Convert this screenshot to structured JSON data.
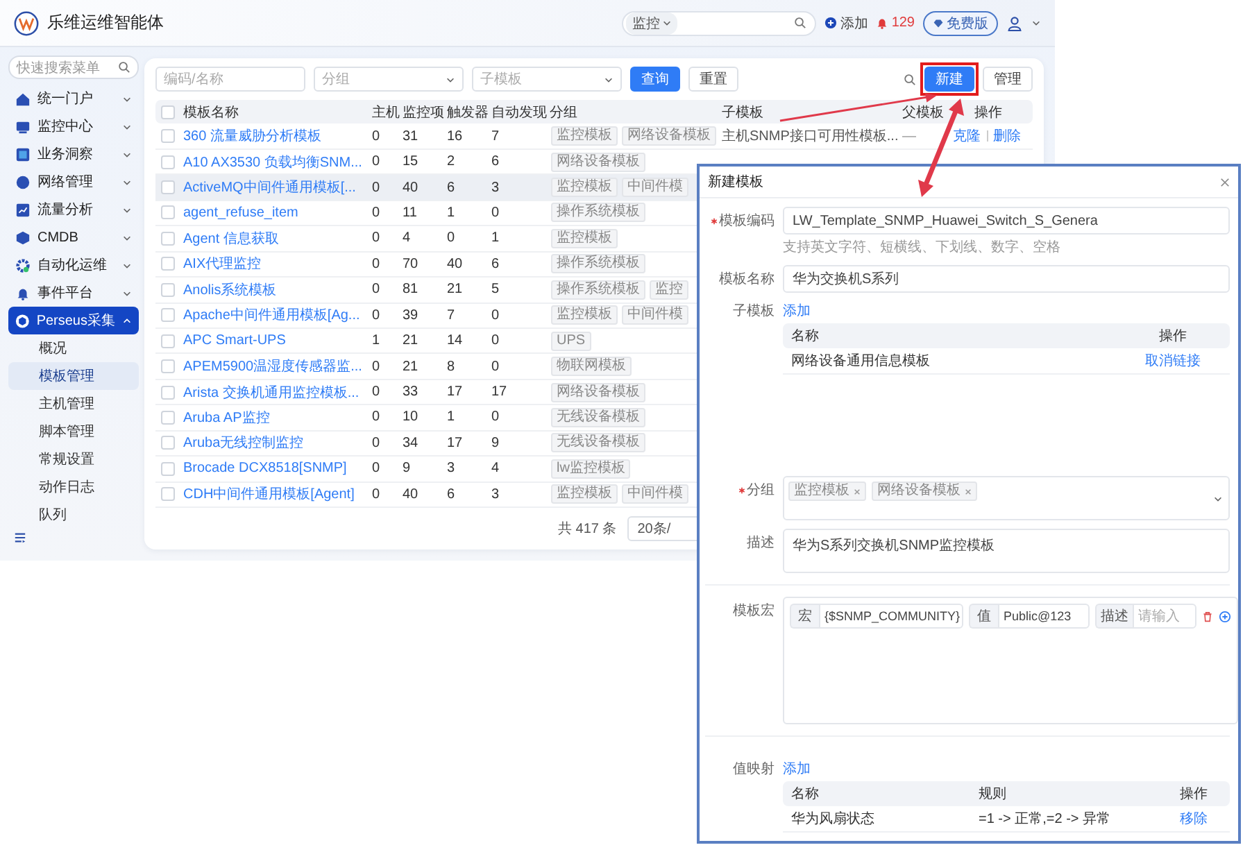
{
  "header": {
    "title": "乐维运维智能体",
    "search_scope": "监控",
    "add": "添加",
    "alert_count": "129",
    "plan": "免费版"
  },
  "sidebar": {
    "search_placeholder": "快速搜索菜单",
    "items": [
      {
        "label": "统一门户",
        "selected": false,
        "expanded": false
      },
      {
        "label": "监控中心",
        "selected": false,
        "expanded": false
      },
      {
        "label": "业务洞察",
        "selected": false,
        "expanded": false
      },
      {
        "label": "网络管理",
        "selected": false,
        "expanded": false
      },
      {
        "label": "流量分析",
        "selected": false,
        "expanded": false
      },
      {
        "label": "CMDB",
        "selected": false,
        "expanded": false
      },
      {
        "label": "自动化运维",
        "selected": false,
        "expanded": false
      },
      {
        "label": "事件平台",
        "selected": false,
        "expanded": false
      },
      {
        "label": "Perseus采集",
        "selected": true,
        "expanded": true,
        "children": [
          {
            "label": "概况",
            "selected": false
          },
          {
            "label": "模板管理",
            "selected": true
          },
          {
            "label": "主机管理",
            "selected": false
          },
          {
            "label": "脚本管理",
            "selected": false
          },
          {
            "label": "常规设置",
            "selected": false
          },
          {
            "label": "动作日志",
            "selected": false
          },
          {
            "label": "队列",
            "selected": false
          }
        ]
      }
    ]
  },
  "filters": {
    "code_placeholder": "编码/名称",
    "group_placeholder": "分组",
    "sub_placeholder": "子模板",
    "query": "查询",
    "reset": "重置",
    "create": "新建",
    "manage": "管理"
  },
  "table": {
    "select_all_checked": false,
    "columns": [
      "模板名称",
      "主机",
      "监控项",
      "触发器",
      "自动发现",
      "分组",
      "子模板",
      "父模板",
      "操作"
    ],
    "rows": [
      {
        "name": "360 流量威胁分析模板",
        "hosts": "0",
        "items": "31",
        "triggers": "16",
        "discovery": "7",
        "groups": [
          "监控模板",
          "网络设备模板"
        ],
        "sub_template": "主机SNMP接口可用性模板...",
        "parent_template": "—",
        "actions": [
          "克隆",
          "删除"
        ],
        "checked": false,
        "hovered": false
      },
      {
        "name": "A10 AX3530 负载均衡SNM...",
        "hosts": "0",
        "items": "15",
        "triggers": "2",
        "discovery": "6",
        "groups": [
          "网络设备模板"
        ],
        "checked": false,
        "hovered": false
      },
      {
        "name": "ActiveMQ中间件通用模板[...",
        "hosts": "0",
        "items": "40",
        "triggers": "6",
        "discovery": "3",
        "groups": [
          "监控模板",
          "中间件模"
        ],
        "checked": false,
        "hovered": true
      },
      {
        "name": "agent_refuse_item",
        "hosts": "0",
        "items": "11",
        "triggers": "1",
        "discovery": "0",
        "groups": [
          "操作系统模板"
        ],
        "checked": false,
        "hovered": false
      },
      {
        "name": "Agent 信息获取",
        "hosts": "0",
        "items": "4",
        "triggers": "0",
        "discovery": "1",
        "groups": [
          "监控模板"
        ],
        "checked": false,
        "hovered": false
      },
      {
        "name": "AIX代理监控",
        "hosts": "0",
        "items": "70",
        "triggers": "40",
        "discovery": "6",
        "groups": [
          "操作系统模板"
        ],
        "checked": false,
        "hovered": false
      },
      {
        "name": "Anolis系统模板",
        "hosts": "0",
        "items": "81",
        "triggers": "21",
        "discovery": "5",
        "groups": [
          "操作系统模板",
          "监控"
        ],
        "checked": false,
        "hovered": false
      },
      {
        "name": "Apache中间件通用模板[Ag...",
        "hosts": "0",
        "items": "39",
        "triggers": "7",
        "discovery": "0",
        "groups": [
          "监控模板",
          "中间件模"
        ],
        "checked": false,
        "hovered": false
      },
      {
        "name": "APC Smart-UPS",
        "hosts": "1",
        "items": "21",
        "triggers": "14",
        "discovery": "0",
        "groups": [
          "UPS"
        ],
        "checked": false,
        "hovered": false
      },
      {
        "name": "APEM5900温湿度传感器监...",
        "hosts": "0",
        "items": "21",
        "triggers": "8",
        "discovery": "0",
        "groups": [
          "物联网模板"
        ],
        "checked": false,
        "hovered": false
      },
      {
        "name": "Arista 交换机通用监控模板...",
        "hosts": "0",
        "items": "33",
        "triggers": "17",
        "discovery": "17",
        "groups": [
          "网络设备模板"
        ],
        "checked": false,
        "hovered": false
      },
      {
        "name": "Aruba AP监控",
        "hosts": "0",
        "items": "10",
        "triggers": "1",
        "discovery": "0",
        "groups": [
          "无线设备模板"
        ],
        "checked": false,
        "hovered": false
      },
      {
        "name": "Aruba无线控制监控",
        "hosts": "0",
        "items": "34",
        "triggers": "17",
        "discovery": "9",
        "groups": [
          "无线设备模板"
        ],
        "checked": false,
        "hovered": false
      },
      {
        "name": "Brocade DCX8518[SNMP]",
        "hosts": "0",
        "items": "9",
        "triggers": "3",
        "discovery": "4",
        "groups": [
          "lw监控模板"
        ],
        "checked": false,
        "hovered": false
      },
      {
        "name": "CDH中间件通用模板[Agent]",
        "hosts": "0",
        "items": "40",
        "triggers": "6",
        "discovery": "3",
        "groups": [
          "监控模板",
          "中间件模"
        ],
        "checked": false,
        "hovered": false
      }
    ]
  },
  "pagination": {
    "total": "共 417 条",
    "page_size": "20条/"
  },
  "dialog": {
    "title": "新建模板",
    "code": {
      "label": "模板编码",
      "required": true,
      "value": "LW_Template_SNMP_Huawei_Switch_S_Genera",
      "hint": "支持英文字符、短横线、下划线、数字、空格"
    },
    "name": {
      "label": "模板名称",
      "required": false,
      "value": "华为交换机S系列"
    },
    "sub_templates": {
      "label": "子模板",
      "add": "添加",
      "columns": [
        "名称",
        "操作"
      ],
      "rows": [
        {
          "name": "网络设备通用信息模板",
          "action": "取消链接"
        }
      ]
    },
    "groups": {
      "label": "分组",
      "required": true,
      "tags": [
        "监控模板",
        "网络设备模板"
      ]
    },
    "description": {
      "label": "描述",
      "value": "华为S系列交换机SNMP监控模板"
    },
    "macros": {
      "label": "模板宏",
      "rows": [
        {
          "macro_label": "宏",
          "macro": "{$SNMP_COMMUNITY}",
          "value_label": "值",
          "value": "Public@123",
          "desc_label": "描述",
          "desc_placeholder": "请输入"
        }
      ]
    },
    "value_maps": {
      "label": "值映射",
      "add": "添加",
      "columns": [
        "名称",
        "规则",
        "操作"
      ],
      "rows": [
        {
          "name": "华为风扇状态",
          "rule": "=1 -> 正常,=2 -> 异常",
          "action": "移除"
        }
      ]
    }
  }
}
